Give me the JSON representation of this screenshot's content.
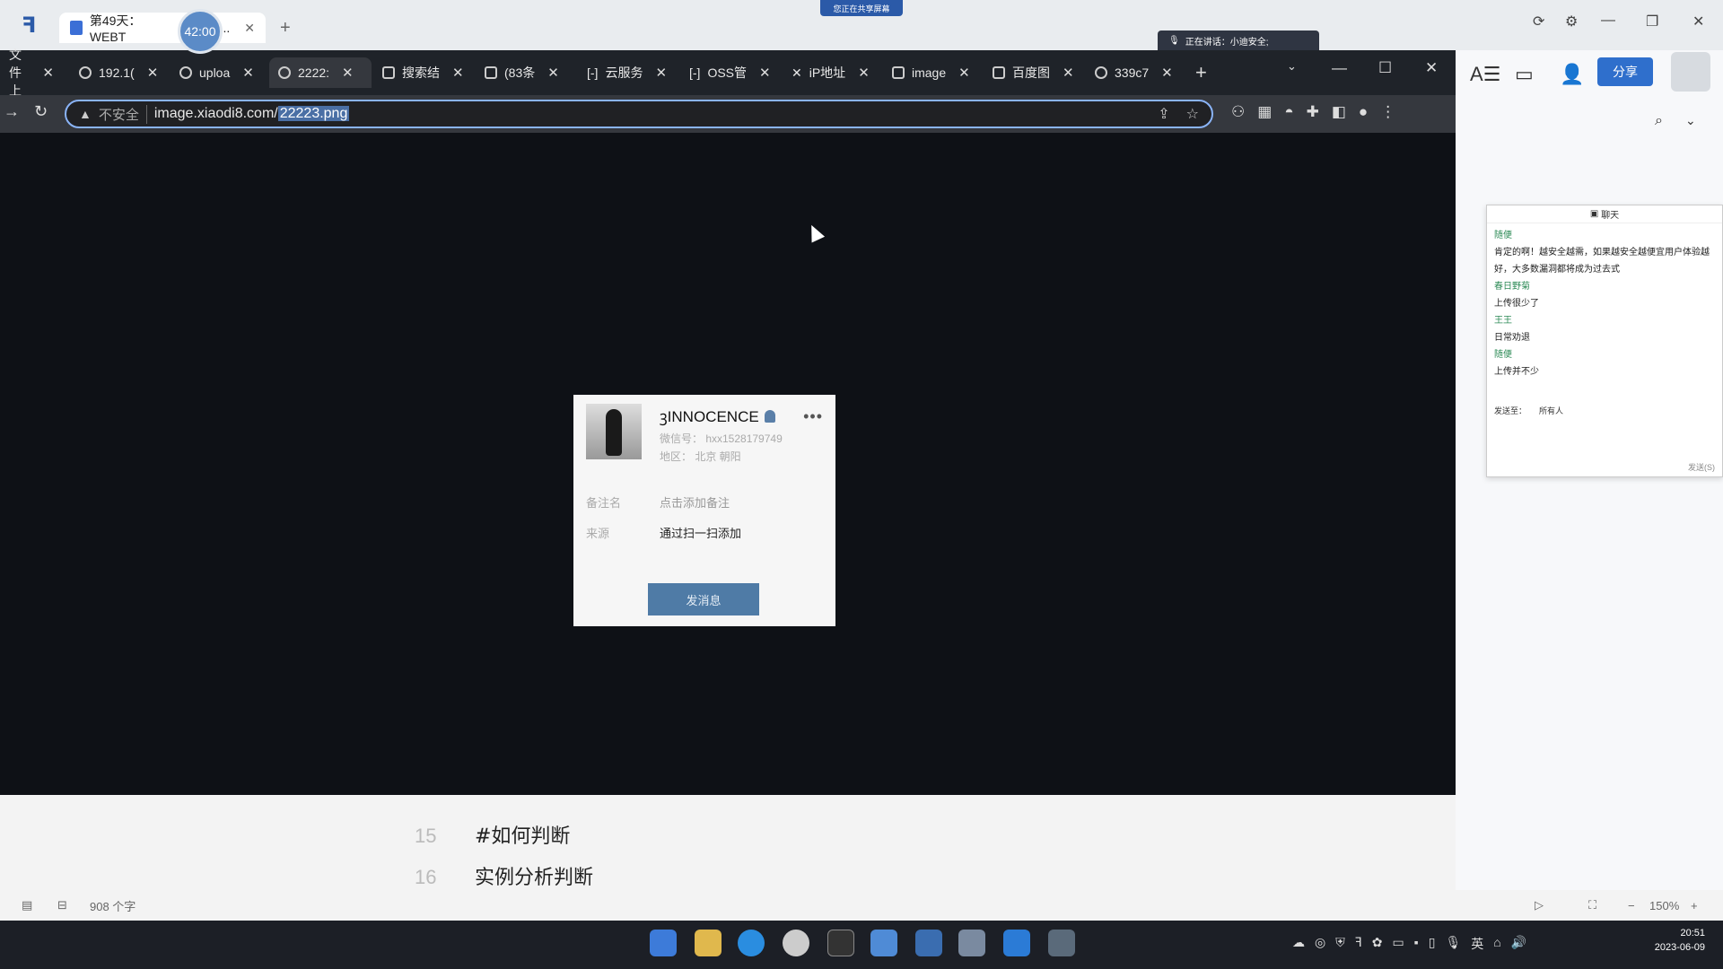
{
  "outer": {
    "tab_title": "第49天：WEBT",
    "tab_ellipsis": "...",
    "timer": "42:00",
    "share_banner": "您正在共享屏幕",
    "speaking": "正在讲话：小迪安全;",
    "share_button": "分享"
  },
  "browser": {
    "tabs": [
      {
        "label": "文件上"
      },
      {
        "label": "192.1("
      },
      {
        "label": "uploa"
      },
      {
        "label": "2222:"
      },
      {
        "label": "搜索结"
      },
      {
        "label": "(83条"
      },
      {
        "label": "云服务"
      },
      {
        "label": "OSS管"
      },
      {
        "label": "iP地址"
      },
      {
        "label": "image"
      },
      {
        "label": "百度图"
      },
      {
        "label": "339c7"
      }
    ],
    "insecure_label": "不安全",
    "url_host": "image.xiaodi8.com/",
    "url_path": "22223.png"
  },
  "card": {
    "name": "ꝫINNOCENCE",
    "wechat_id": "微信号：   hxx1528179749",
    "region": "地区：   北京  朝阳",
    "remark_label": "备注名",
    "remark_value": "点击添加备注",
    "source_label": "来源",
    "source_value": "通过扫一扫添加",
    "send_button": "发消息"
  },
  "chat": {
    "title": "聊天",
    "messages": [
      {
        "name": "随便",
        "text": "肯定的啊！越安全越需，如果越安全越便宜用户体验越好，大多数漏洞都将成为过去式"
      },
      {
        "name": "春日野菊",
        "text": "上传很少了"
      },
      {
        "name": "王王",
        "text": "日常劝退"
      },
      {
        "name": "随便",
        "text": "上传并不少"
      }
    ],
    "send_to_label": "发送至：",
    "send_to_value": "所有人",
    "send_hint": "发送(S)"
  },
  "doc": {
    "lines": [
      {
        "num": "15",
        "text": "#如何判断"
      },
      {
        "num": "16",
        "text": "实例分析判断"
      }
    ],
    "word_count": "908 个字",
    "zoom": "150%"
  },
  "taskbar": {
    "time": "20:51",
    "date": "2023-06-09",
    "ime": "英"
  }
}
